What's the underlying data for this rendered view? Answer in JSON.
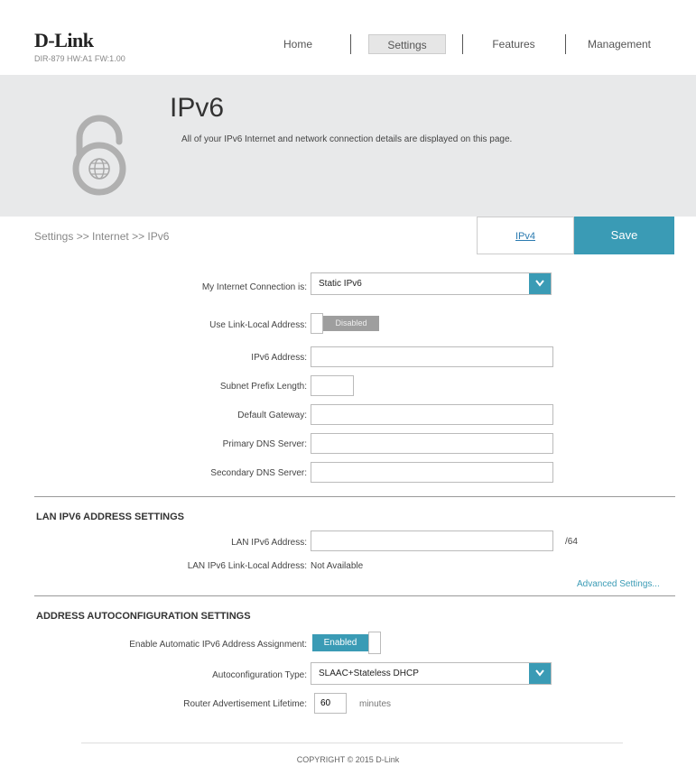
{
  "header": {
    "brand": "D-Link",
    "model": "DIR-879 HW:A1 FW:1.00",
    "nav": {
      "home": "Home",
      "settings": "Settings",
      "features": "Features",
      "management": "Management"
    }
  },
  "banner": {
    "title": "IPv6",
    "description": "All of your IPv6 Internet and network connection details are displayed on this page."
  },
  "breadcrumb": "Settings >> Internet >> IPv6",
  "actions": {
    "ipv4": "IPv4",
    "save": "Save"
  },
  "ipv6_form": {
    "connection_label": "My Internet Connection is:",
    "connection_value": "Static IPv6",
    "link_local_label": "Use Link-Local Address:",
    "link_local_state": "Disabled",
    "ipv6_address_label": "IPv6 Address:",
    "ipv6_address_value": "",
    "subnet_prefix_label": "Subnet Prefix Length:",
    "subnet_prefix_value": "",
    "default_gateway_label": "Default Gateway:",
    "default_gateway_value": "",
    "primary_dns_label": "Primary DNS Server:",
    "primary_dns_value": "",
    "secondary_dns_label": "Secondary DNS Server:",
    "secondary_dns_value": ""
  },
  "lan_section": {
    "title": "LAN IPV6 ADDRESS SETTINGS",
    "lan_address_label": "LAN IPv6 Address:",
    "lan_address_value": "",
    "lan_suffix": "/64",
    "link_local_label": "LAN IPv6 Link-Local Address:",
    "link_local_value": "Not Available",
    "advanced_link": "Advanced Settings..."
  },
  "autoconfig_section": {
    "title": "ADDRESS AUTOCONFIGURATION SETTINGS",
    "auto_assign_label": "Enable Automatic IPv6 Address Assignment:",
    "auto_assign_state": "Enabled",
    "type_label": "Autoconfiguration Type:",
    "type_value": "SLAAC+Stateless DHCP",
    "lifetime_label": "Router Advertisement Lifetime:",
    "lifetime_value": "60",
    "lifetime_unit": "minutes"
  },
  "footer": "COPYRIGHT © 2015 D-Link",
  "colors": {
    "accent": "#3a9bb5",
    "banner_bg": "#e8e9ea",
    "toggle_off": "#9e9e9e"
  },
  "icons": {
    "banner": "lock-globe-icon",
    "dropdown": "chevron-down-icon"
  }
}
